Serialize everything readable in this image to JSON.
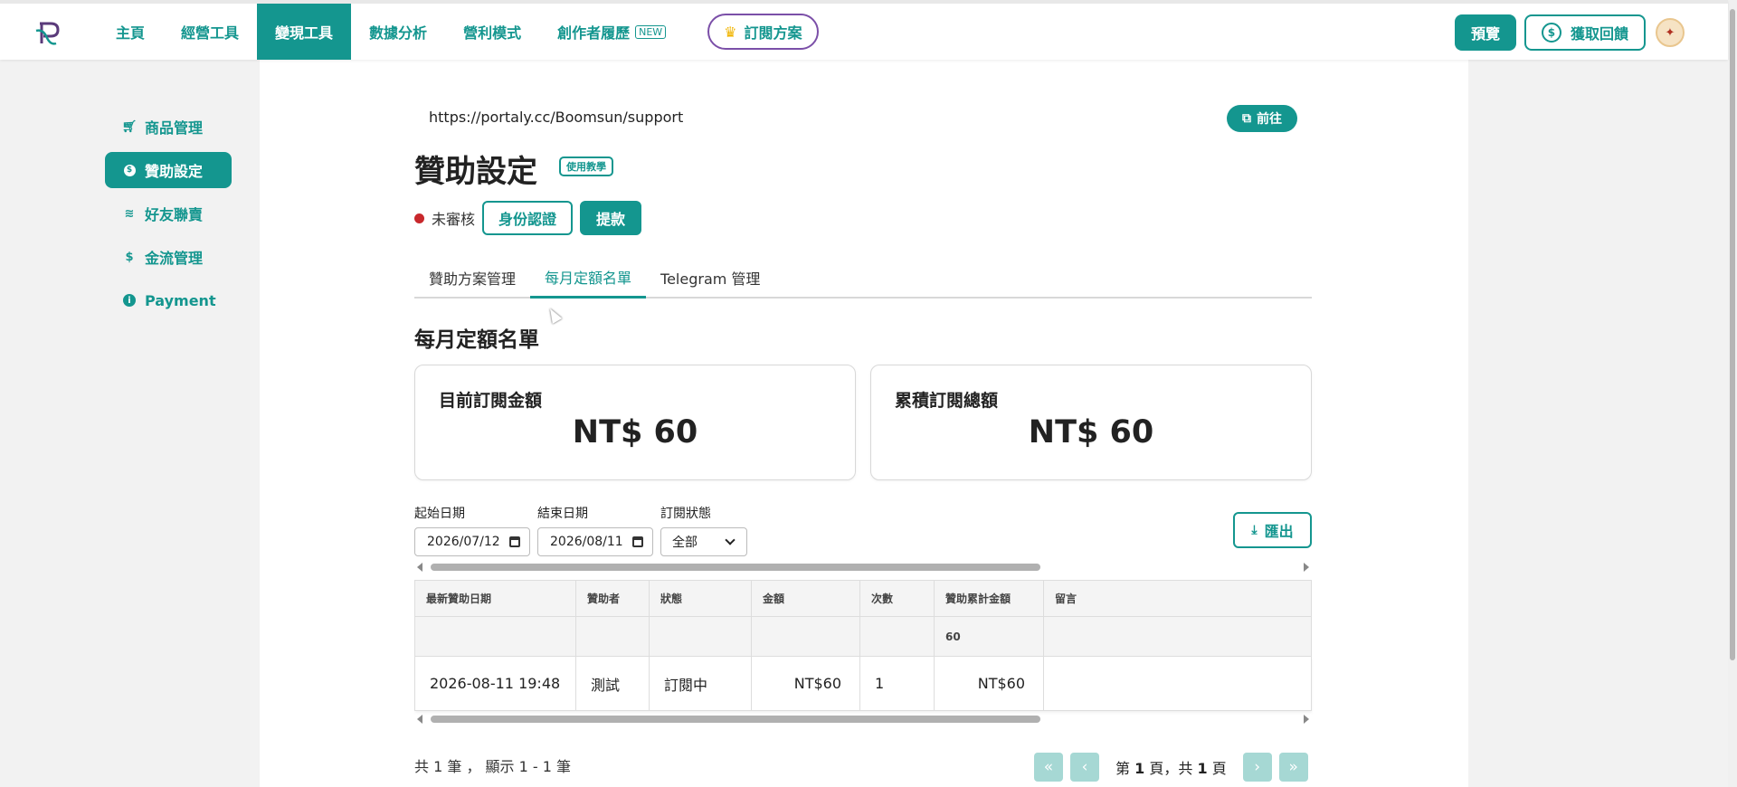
{
  "topnav": {
    "items": [
      {
        "label": "主頁"
      },
      {
        "label": "經營工具"
      },
      {
        "label": "變現工具"
      },
      {
        "label": "數據分析"
      },
      {
        "label": "營利模式"
      },
      {
        "label": "創作者履歷"
      }
    ],
    "new_badge": "NEW",
    "subscribe_label": "訂閱方案",
    "preview_label": "預覽",
    "reward_label": "獲取回饋",
    "active_index": 2
  },
  "sidebar": {
    "items": [
      {
        "label": "商品管理",
        "icon": "cart-icon"
      },
      {
        "label": "贊助設定",
        "icon": "coin-icon"
      },
      {
        "label": "好友聯賣",
        "icon": "coins-stack-icon"
      },
      {
        "label": "金流管理",
        "icon": "dollar-icon"
      },
      {
        "label": "Payment",
        "icon": "info-icon"
      }
    ],
    "active_index": 1
  },
  "main": {
    "url": "https://portaly.cc/Boomsun/support",
    "goto_label": "前往",
    "title": "贊助設定",
    "tutorial_label": "使用教學",
    "status_text": "未審核",
    "id_button": "身份認證",
    "withdraw_button": "提款",
    "tabs": [
      {
        "label": "贊助方案管理"
      },
      {
        "label": "每月定額名單"
      },
      {
        "label": "Telegram 管理"
      }
    ],
    "active_tab": 1,
    "section_title": "每月定額名單",
    "cards": [
      {
        "label": "目前訂閱金額",
        "value": "NT$ 60"
      },
      {
        "label": "累積訂閱總額",
        "value": "NT$ 60"
      }
    ],
    "filters": {
      "start_label": "起始日期",
      "start_value": "2026/07/12",
      "end_label": "結束日期",
      "end_value": "2026/08/11",
      "status_label": "訂閱狀態",
      "status_value": "全部"
    },
    "export_label": "匯出",
    "table": {
      "columns": [
        "最新贊助日期",
        "贊助者",
        "狀態",
        "金額",
        "次數",
        "贊助累計金額",
        "留言"
      ],
      "summary": [
        "",
        "",
        "",
        "",
        "",
        "60",
        ""
      ],
      "rows": [
        [
          "2026-08-11 19:48",
          "測試",
          "訂閱中",
          "NT$60",
          "1",
          "NT$60",
          ""
        ]
      ]
    },
    "footer": {
      "count_text": "共 1 筆 ， 顯示 1 - 1 筆",
      "page_prefix": "第",
      "page_current": "1",
      "page_mid": "頁，共",
      "page_total": "1",
      "page_suffix": "頁"
    }
  },
  "colors": {
    "accent": "#14968f",
    "status_red": "#c8282c",
    "subscribe_border": "#7b4fa8"
  }
}
